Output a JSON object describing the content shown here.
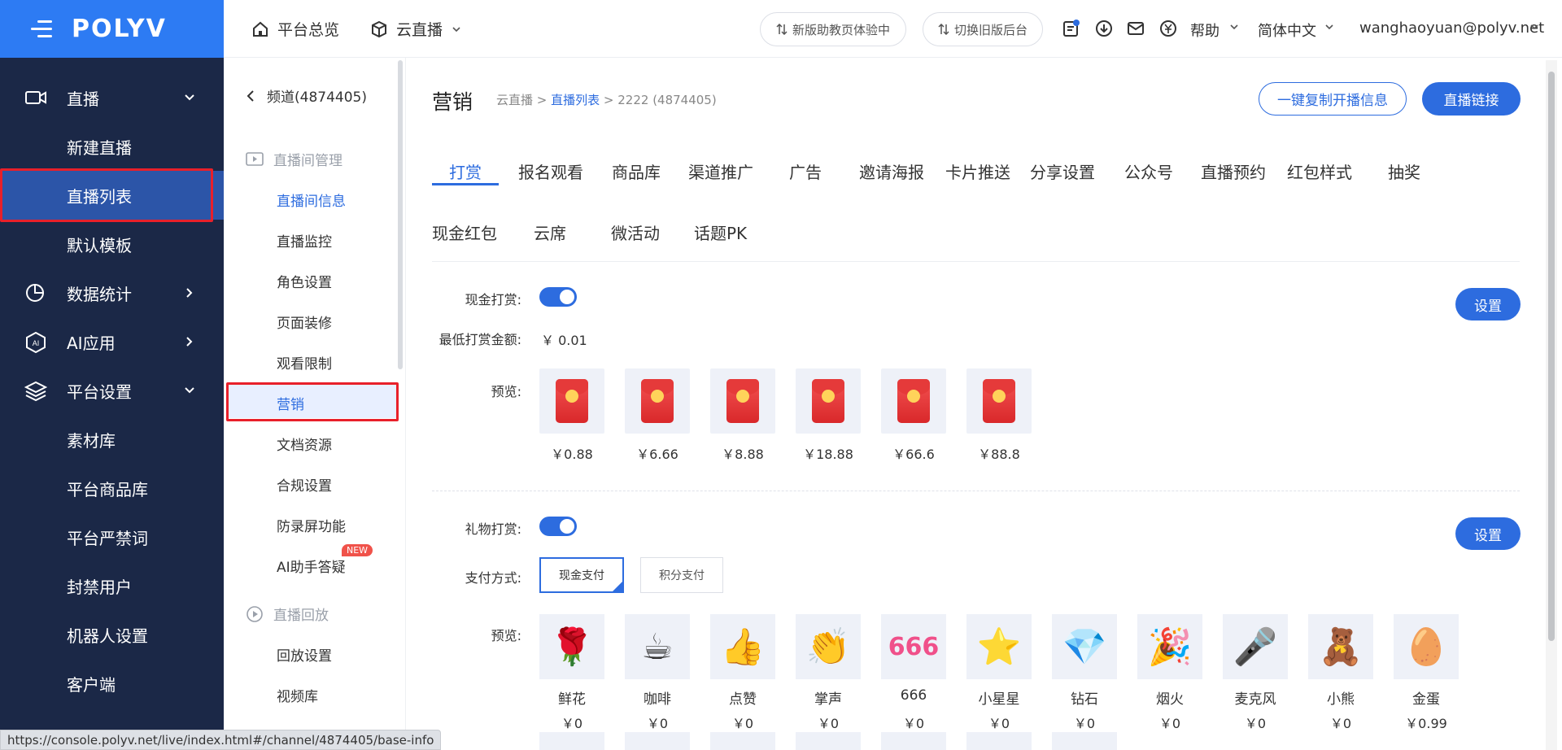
{
  "brand": {
    "logo": "POLYV"
  },
  "topbar": {
    "home": "平台总览",
    "product": "云直播",
    "btn_new_ui": "新版助教页体验中",
    "btn_old_ui": "切换旧版后台",
    "help": "帮助",
    "language": "简体中文",
    "account": "wanghaoyuan@polyv.net"
  },
  "sidebar": {
    "items": [
      {
        "label": "直播"
      },
      {
        "label": "新建直播"
      },
      {
        "label": "直播列表"
      },
      {
        "label": "默认模板"
      },
      {
        "label": "数据统计"
      },
      {
        "label": "AI应用"
      },
      {
        "label": "平台设置"
      },
      {
        "label": "素材库"
      },
      {
        "label": "平台商品库"
      },
      {
        "label": "平台严禁词"
      },
      {
        "label": "封禁用户"
      },
      {
        "label": "机器人设置"
      },
      {
        "label": "客户端"
      }
    ]
  },
  "panel2": {
    "channel": "频道(4874405)",
    "group1": "直播间管理",
    "items": [
      "直播间信息",
      "直播监控",
      "角色设置",
      "页面装修",
      "观看限制",
      "营销",
      "文档资源",
      "合规设置",
      "防录屏功能",
      "AI助手答疑"
    ],
    "new_badge": "NEW",
    "group2": "直播回放",
    "items2": [
      "回放设置",
      "视频库"
    ]
  },
  "page": {
    "title": "营销",
    "crumb_root": "云直播",
    "crumb_link": "直播列表",
    "crumb_current": "2222 (4874405)",
    "copy_button": "一键复制开播信息",
    "live_link_button": "直播链接"
  },
  "tabs_row1": [
    "打赏",
    "报名观看",
    "商品库",
    "渠道推广",
    "广告",
    "邀请海报",
    "卡片推送",
    "分享设置",
    "公众号",
    "直播预约",
    "红包样式",
    "抽奖"
  ],
  "tabs_row2": [
    "现金红包",
    "云席",
    "微活动",
    "话题PK"
  ],
  "cash_reward": {
    "label": "现金打赏:",
    "enabled": true,
    "min_label": "最低打赏金额:",
    "min_value": "￥ 0.01",
    "preview_label": "预览:",
    "settings_button": "设置",
    "amounts": [
      "￥0.88",
      "￥6.66",
      "￥8.88",
      "￥18.88",
      "￥66.6",
      "￥88.8"
    ]
  },
  "gift_reward": {
    "label": "礼物打赏:",
    "enabled": true,
    "pay_label": "支付方式:",
    "pay_cash": "现金支付",
    "pay_points": "积分支付",
    "preview_label": "预览:",
    "settings_button": "设置",
    "gifts": [
      {
        "name": "鲜花",
        "price": "￥0",
        "icon": "🌹"
      },
      {
        "name": "咖啡",
        "price": "￥0",
        "icon": "☕"
      },
      {
        "name": "点赞",
        "price": "￥0",
        "icon": "👍"
      },
      {
        "name": "掌声",
        "price": "￥0",
        "icon": "👏"
      },
      {
        "name": "666",
        "price": "￥0",
        "icon": "666"
      },
      {
        "name": "小星星",
        "price": "￥0",
        "icon": "⭐"
      },
      {
        "name": "钻石",
        "price": "￥0",
        "icon": "💎"
      },
      {
        "name": "烟火",
        "price": "￥0",
        "icon": "🎉"
      },
      {
        "name": "麦克风",
        "price": "￥0",
        "icon": "🎤"
      },
      {
        "name": "小熊",
        "price": "￥0",
        "icon": "🧸"
      },
      {
        "name": "金蛋",
        "price": "￥0.99",
        "icon": "🥚"
      }
    ]
  },
  "status_url": "https://console.polyv.net/live/index.html#/channel/4874405/base-info",
  "colors": {
    "primary": "#2d6cdf",
    "sidebar": "#1b2847",
    "logo_bar": "#2d7bf3",
    "highlight": "#e8202a"
  }
}
